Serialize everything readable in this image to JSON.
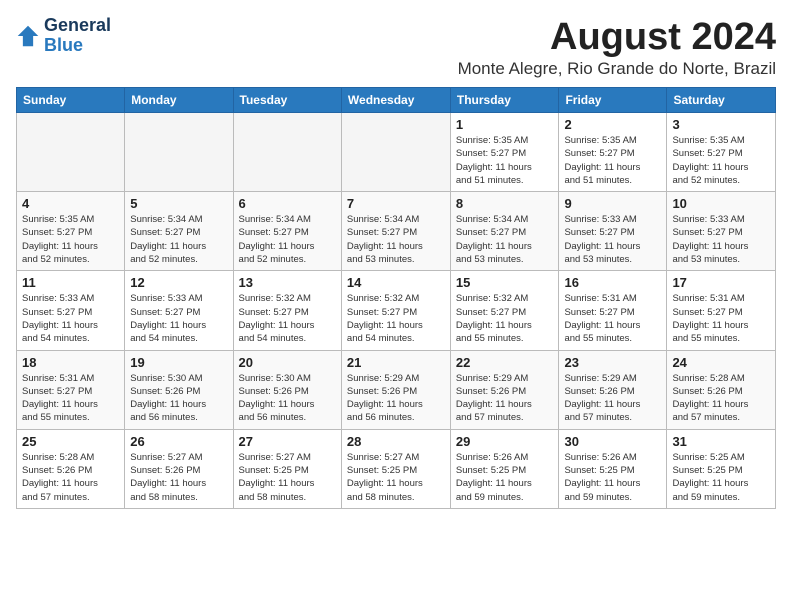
{
  "header": {
    "logo_line1": "General",
    "logo_line2": "Blue",
    "title": "August 2024",
    "subtitle": "Monte Alegre, Rio Grande do Norte, Brazil"
  },
  "weekdays": [
    "Sunday",
    "Monday",
    "Tuesday",
    "Wednesday",
    "Thursday",
    "Friday",
    "Saturday"
  ],
  "weeks": [
    [
      {
        "day": "",
        "info": ""
      },
      {
        "day": "",
        "info": ""
      },
      {
        "day": "",
        "info": ""
      },
      {
        "day": "",
        "info": ""
      },
      {
        "day": "1",
        "info": "Sunrise: 5:35 AM\nSunset: 5:27 PM\nDaylight: 11 hours\nand 51 minutes."
      },
      {
        "day": "2",
        "info": "Sunrise: 5:35 AM\nSunset: 5:27 PM\nDaylight: 11 hours\nand 51 minutes."
      },
      {
        "day": "3",
        "info": "Sunrise: 5:35 AM\nSunset: 5:27 PM\nDaylight: 11 hours\nand 52 minutes."
      }
    ],
    [
      {
        "day": "4",
        "info": "Sunrise: 5:35 AM\nSunset: 5:27 PM\nDaylight: 11 hours\nand 52 minutes."
      },
      {
        "day": "5",
        "info": "Sunrise: 5:34 AM\nSunset: 5:27 PM\nDaylight: 11 hours\nand 52 minutes."
      },
      {
        "day": "6",
        "info": "Sunrise: 5:34 AM\nSunset: 5:27 PM\nDaylight: 11 hours\nand 52 minutes."
      },
      {
        "day": "7",
        "info": "Sunrise: 5:34 AM\nSunset: 5:27 PM\nDaylight: 11 hours\nand 53 minutes."
      },
      {
        "day": "8",
        "info": "Sunrise: 5:34 AM\nSunset: 5:27 PM\nDaylight: 11 hours\nand 53 minutes."
      },
      {
        "day": "9",
        "info": "Sunrise: 5:33 AM\nSunset: 5:27 PM\nDaylight: 11 hours\nand 53 minutes."
      },
      {
        "day": "10",
        "info": "Sunrise: 5:33 AM\nSunset: 5:27 PM\nDaylight: 11 hours\nand 53 minutes."
      }
    ],
    [
      {
        "day": "11",
        "info": "Sunrise: 5:33 AM\nSunset: 5:27 PM\nDaylight: 11 hours\nand 54 minutes."
      },
      {
        "day": "12",
        "info": "Sunrise: 5:33 AM\nSunset: 5:27 PM\nDaylight: 11 hours\nand 54 minutes."
      },
      {
        "day": "13",
        "info": "Sunrise: 5:32 AM\nSunset: 5:27 PM\nDaylight: 11 hours\nand 54 minutes."
      },
      {
        "day": "14",
        "info": "Sunrise: 5:32 AM\nSunset: 5:27 PM\nDaylight: 11 hours\nand 54 minutes."
      },
      {
        "day": "15",
        "info": "Sunrise: 5:32 AM\nSunset: 5:27 PM\nDaylight: 11 hours\nand 55 minutes."
      },
      {
        "day": "16",
        "info": "Sunrise: 5:31 AM\nSunset: 5:27 PM\nDaylight: 11 hours\nand 55 minutes."
      },
      {
        "day": "17",
        "info": "Sunrise: 5:31 AM\nSunset: 5:27 PM\nDaylight: 11 hours\nand 55 minutes."
      }
    ],
    [
      {
        "day": "18",
        "info": "Sunrise: 5:31 AM\nSunset: 5:27 PM\nDaylight: 11 hours\nand 55 minutes."
      },
      {
        "day": "19",
        "info": "Sunrise: 5:30 AM\nSunset: 5:26 PM\nDaylight: 11 hours\nand 56 minutes."
      },
      {
        "day": "20",
        "info": "Sunrise: 5:30 AM\nSunset: 5:26 PM\nDaylight: 11 hours\nand 56 minutes."
      },
      {
        "day": "21",
        "info": "Sunrise: 5:29 AM\nSunset: 5:26 PM\nDaylight: 11 hours\nand 56 minutes."
      },
      {
        "day": "22",
        "info": "Sunrise: 5:29 AM\nSunset: 5:26 PM\nDaylight: 11 hours\nand 57 minutes."
      },
      {
        "day": "23",
        "info": "Sunrise: 5:29 AM\nSunset: 5:26 PM\nDaylight: 11 hours\nand 57 minutes."
      },
      {
        "day": "24",
        "info": "Sunrise: 5:28 AM\nSunset: 5:26 PM\nDaylight: 11 hours\nand 57 minutes."
      }
    ],
    [
      {
        "day": "25",
        "info": "Sunrise: 5:28 AM\nSunset: 5:26 PM\nDaylight: 11 hours\nand 57 minutes."
      },
      {
        "day": "26",
        "info": "Sunrise: 5:27 AM\nSunset: 5:26 PM\nDaylight: 11 hours\nand 58 minutes."
      },
      {
        "day": "27",
        "info": "Sunrise: 5:27 AM\nSunset: 5:25 PM\nDaylight: 11 hours\nand 58 minutes."
      },
      {
        "day": "28",
        "info": "Sunrise: 5:27 AM\nSunset: 5:25 PM\nDaylight: 11 hours\nand 58 minutes."
      },
      {
        "day": "29",
        "info": "Sunrise: 5:26 AM\nSunset: 5:25 PM\nDaylight: 11 hours\nand 59 minutes."
      },
      {
        "day": "30",
        "info": "Sunrise: 5:26 AM\nSunset: 5:25 PM\nDaylight: 11 hours\nand 59 minutes."
      },
      {
        "day": "31",
        "info": "Sunrise: 5:25 AM\nSunset: 5:25 PM\nDaylight: 11 hours\nand 59 minutes."
      }
    ]
  ]
}
